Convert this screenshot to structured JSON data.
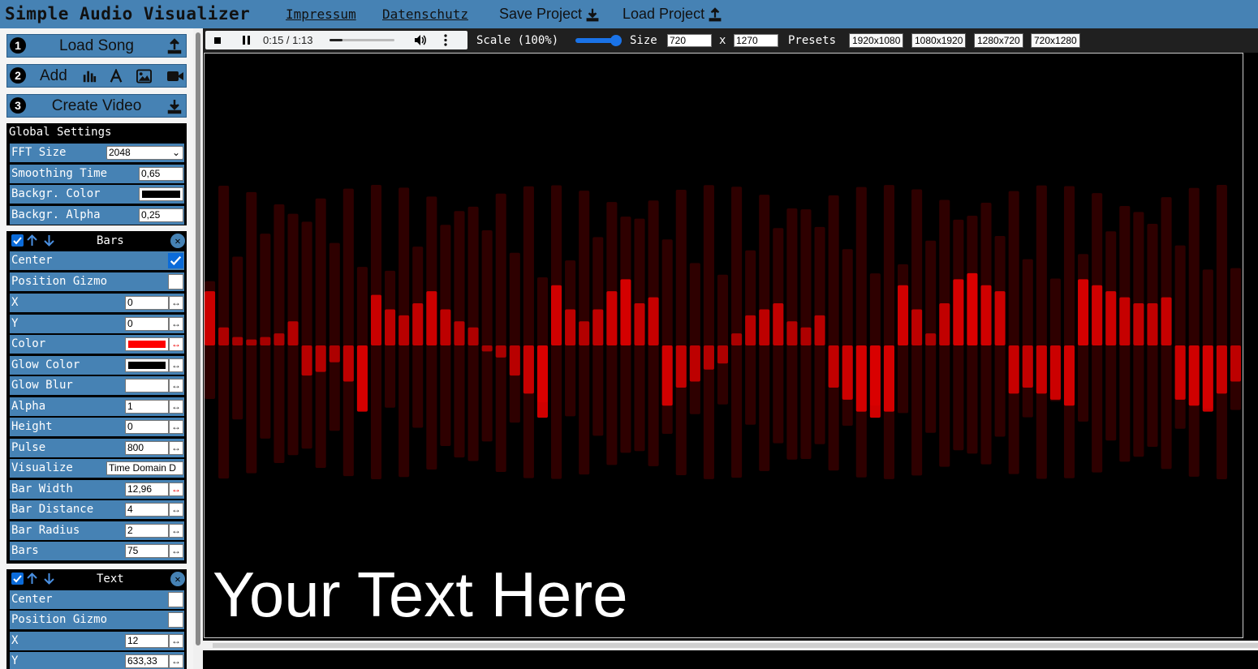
{
  "header": {
    "title": "Simple Audio Visualizer",
    "links": [
      "Impressum",
      "Datenschutz"
    ],
    "save_label": "Save Project",
    "load_label": "Load Project"
  },
  "steps": [
    {
      "num": "1",
      "label": "Load Song"
    },
    {
      "num": "2",
      "label": "Add"
    },
    {
      "num": "3",
      "label": "Create Video"
    }
  ],
  "global": {
    "title": "Global Settings",
    "rows": [
      {
        "label": "FFT Size",
        "value": "2048"
      },
      {
        "label": "Smoothing Time",
        "value": "0,65"
      },
      {
        "label": "Backgr. Color",
        "value": ""
      },
      {
        "label": "Backgr. Alpha",
        "value": "0,25"
      }
    ]
  },
  "bars": {
    "title": "Bars",
    "center_label": "Center",
    "gizmo_label": "Position Gizmo",
    "rows": [
      {
        "label": "X",
        "value": "0"
      },
      {
        "label": "Y",
        "value": "0"
      },
      {
        "label": "Color",
        "value": ""
      },
      {
        "label": "Glow Color",
        "value": ""
      },
      {
        "label": "Glow Blur",
        "value": ""
      },
      {
        "label": "Alpha",
        "value": "1"
      },
      {
        "label": "Height",
        "value": "0"
      },
      {
        "label": "Pulse",
        "value": "800"
      },
      {
        "label": "Visualize",
        "value": "Time Domain D"
      },
      {
        "label": "Bar Width",
        "value": "12,96"
      },
      {
        "label": "Bar Distance",
        "value": "4"
      },
      {
        "label": "Bar Radius",
        "value": "2"
      },
      {
        "label": "Bars",
        "value": "75"
      }
    ]
  },
  "text": {
    "title": "Text",
    "center_label": "Center",
    "gizmo_label": "Position Gizmo",
    "rows": [
      {
        "label": "X",
        "value": "12"
      },
      {
        "label": "Y",
        "value": "633,33"
      }
    ]
  },
  "player": {
    "time": "0:15 / 1:13",
    "progress": 0.2
  },
  "toolbar": {
    "scale_label": "Scale (100%)",
    "size_label": "Size",
    "width": "720",
    "x_label": "x",
    "height": "1270",
    "presets_label": "Presets",
    "presets": [
      "1920x1080",
      "1080x1920",
      "1280x720",
      "720x1280"
    ]
  },
  "visual": {
    "text": "Your Text Here",
    "bar_color": "#ff0000",
    "bar_count": 75,
    "levels": [
      0.45,
      0.15,
      0.07,
      0.05,
      0.07,
      0.1,
      0.2,
      0.25,
      0.22,
      0.14,
      0.3,
      0.55,
      0.42,
      0.3,
      0.25,
      0.35,
      0.45,
      0.3,
      0.2,
      0.15,
      0.05,
      0.1,
      0.25,
      0.4,
      0.6,
      0.5,
      0.3,
      0.2,
      0.3,
      0.45,
      0.55,
      0.35,
      0.4,
      0.5,
      0.35,
      0.3,
      0.2,
      0.15,
      0.1,
      0.25,
      0.3,
      0.35,
      0.2,
      0.15,
      0.25,
      0.35,
      0.45,
      0.55,
      0.6,
      0.55,
      0.5,
      0.3,
      0.1,
      0.35,
      0.55,
      0.6,
      0.5,
      0.45,
      0.4,
      0.35,
      0.4,
      0.45,
      0.5,
      0.55,
      0.5,
      0.45,
      0.4,
      0.35,
      0.35,
      0.4,
      0.45,
      0.5,
      0.55,
      0.4,
      0.3
    ]
  }
}
